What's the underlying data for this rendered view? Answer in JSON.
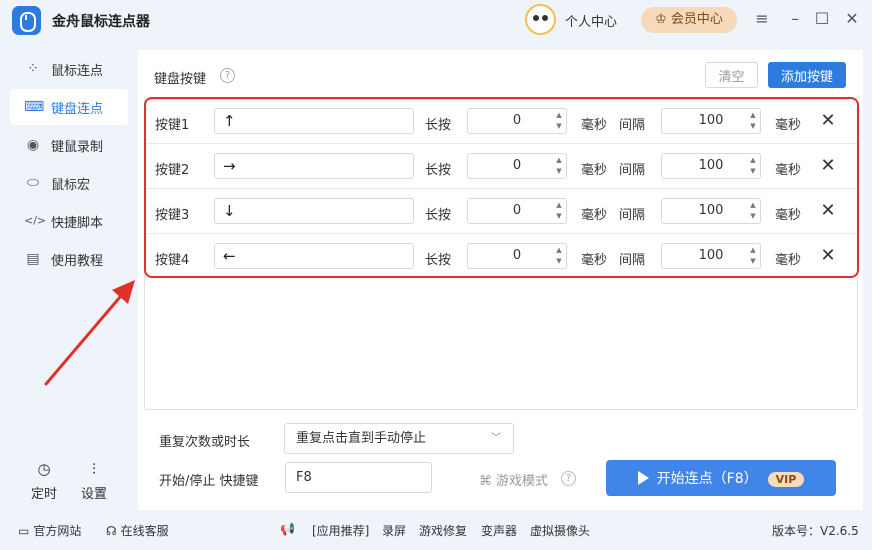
{
  "app": {
    "title": "金舟鼠标连点器"
  },
  "header": {
    "personal_center": "个人中心",
    "vip_center": "会员中心"
  },
  "sidebar": {
    "items": [
      {
        "label": "鼠标连点",
        "icon": "cursor-click-icon",
        "active": false
      },
      {
        "label": "键盘连点",
        "icon": "keyboard-icon",
        "active": true
      },
      {
        "label": "键鼠录制",
        "icon": "record-icon",
        "active": false
      },
      {
        "label": "鼠标宏",
        "icon": "mouse-icon",
        "active": false
      },
      {
        "label": "快捷脚本",
        "icon": "code-icon",
        "active": false
      },
      {
        "label": "使用教程",
        "icon": "document-icon",
        "active": false
      }
    ],
    "bottom": {
      "timer_label": "定时",
      "settings_label": "设置"
    }
  },
  "main": {
    "section_title": "键盘按键",
    "clear_label": "清空",
    "add_key_label": "添加按键",
    "keys": [
      {
        "name": "按键1",
        "key": "↑",
        "press_label": "长按",
        "press_ms": "0",
        "ms_label": "毫秒",
        "interval_label": "间隔",
        "interval_ms": "100"
      },
      {
        "name": "按键2",
        "key": "→",
        "press_label": "长按",
        "press_ms": "0",
        "ms_label": "毫秒",
        "interval_label": "间隔",
        "interval_ms": "100"
      },
      {
        "name": "按键3",
        "key": "↓",
        "press_label": "长按",
        "press_ms": "0",
        "ms_label": "毫秒",
        "interval_label": "间隔",
        "interval_ms": "100"
      },
      {
        "name": "按键4",
        "key": "←",
        "press_label": "长按",
        "press_ms": "0",
        "ms_label": "毫秒",
        "interval_label": "间隔",
        "interval_ms": "100"
      }
    ],
    "repeat_label": "重复次数或时长",
    "repeat_value": "重复点击直到手动停止",
    "hotkey_label": "开始/停止 快捷键",
    "hotkey_value": "F8",
    "game_mode_label": "游戏模式",
    "start_label": "开始连点（F8）",
    "vip_badge": "VIP"
  },
  "statusbar": {
    "website": "官方网站",
    "support": "在线客服",
    "recommend": "[应用推荐]",
    "record_screen": "录屏",
    "game_repair": "游戏修复",
    "voice_changer": "变声器",
    "virtual_camera": "虚拟摄像头",
    "version": "版本号：V2.6.5"
  },
  "colors": {
    "accent": "#2e7be0",
    "highlight": "#e0302a",
    "vip": "#f5d9b9"
  }
}
